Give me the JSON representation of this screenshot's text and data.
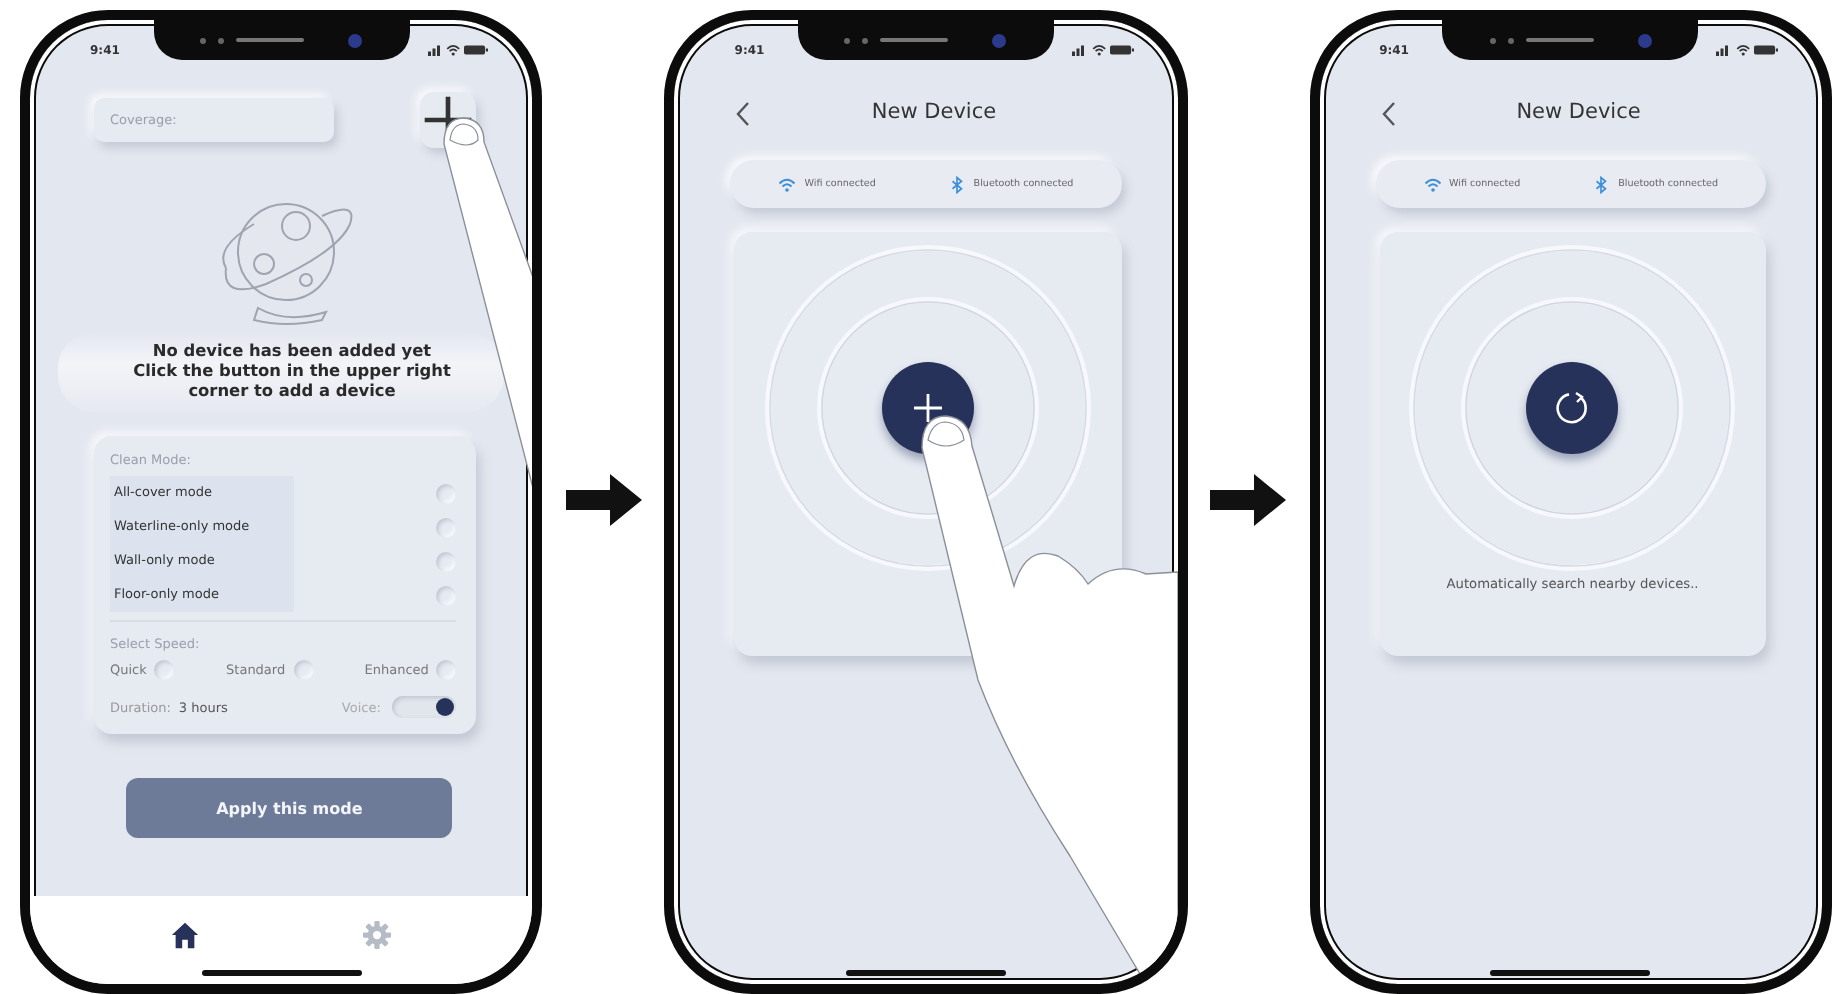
{
  "screens": [
    {
      "kind": "home",
      "time": "9:41",
      "coverage": {
        "placeholder": "Coverage:"
      },
      "empty_message": {
        "title": "No device has been added yet",
        "hint": "Click the button in the upper right corner to add a device"
      },
      "clean_mode": {
        "title": "Clean Mode:",
        "modes": [
          {
            "label": "All-cover mode",
            "selected": false
          },
          {
            "label": "Waterline-only mode",
            "selected": false
          },
          {
            "label": "Wall-only mode",
            "selected": false
          },
          {
            "label": "Floor-only mode",
            "selected": false
          }
        ]
      },
      "speed": {
        "title": "Select Speed:",
        "options": [
          {
            "label": "Quick",
            "selected": false
          },
          {
            "label": "Standard",
            "selected": false
          },
          {
            "label": "Enhanced",
            "selected": false
          }
        ]
      },
      "duration": {
        "label": "Duration:",
        "value": "3 hours"
      },
      "voice": {
        "label": "Voice:",
        "on": true
      },
      "apply_button": "Apply this mode",
      "nav": [
        {
          "kind": "home",
          "selected": true
        },
        {
          "kind": "settings",
          "selected": false
        }
      ]
    },
    {
      "kind": "device",
      "time": "9:41",
      "title": "New Device",
      "connections": [
        {
          "kind": "wifi",
          "label": "Wifi connected"
        },
        {
          "kind": "bluetooth",
          "label": "Bluetooth connected"
        }
      ],
      "button": {
        "kind": "add"
      }
    },
    {
      "kind": "device",
      "time": "9:41",
      "title": "New Device",
      "connections": [
        {
          "kind": "wifi",
          "label": "Wifi connected"
        },
        {
          "kind": "bluetooth",
          "label": "Bluetooth connected"
        }
      ],
      "button": {
        "kind": "search"
      },
      "message": "Automatically search nearby devices.."
    }
  ]
}
